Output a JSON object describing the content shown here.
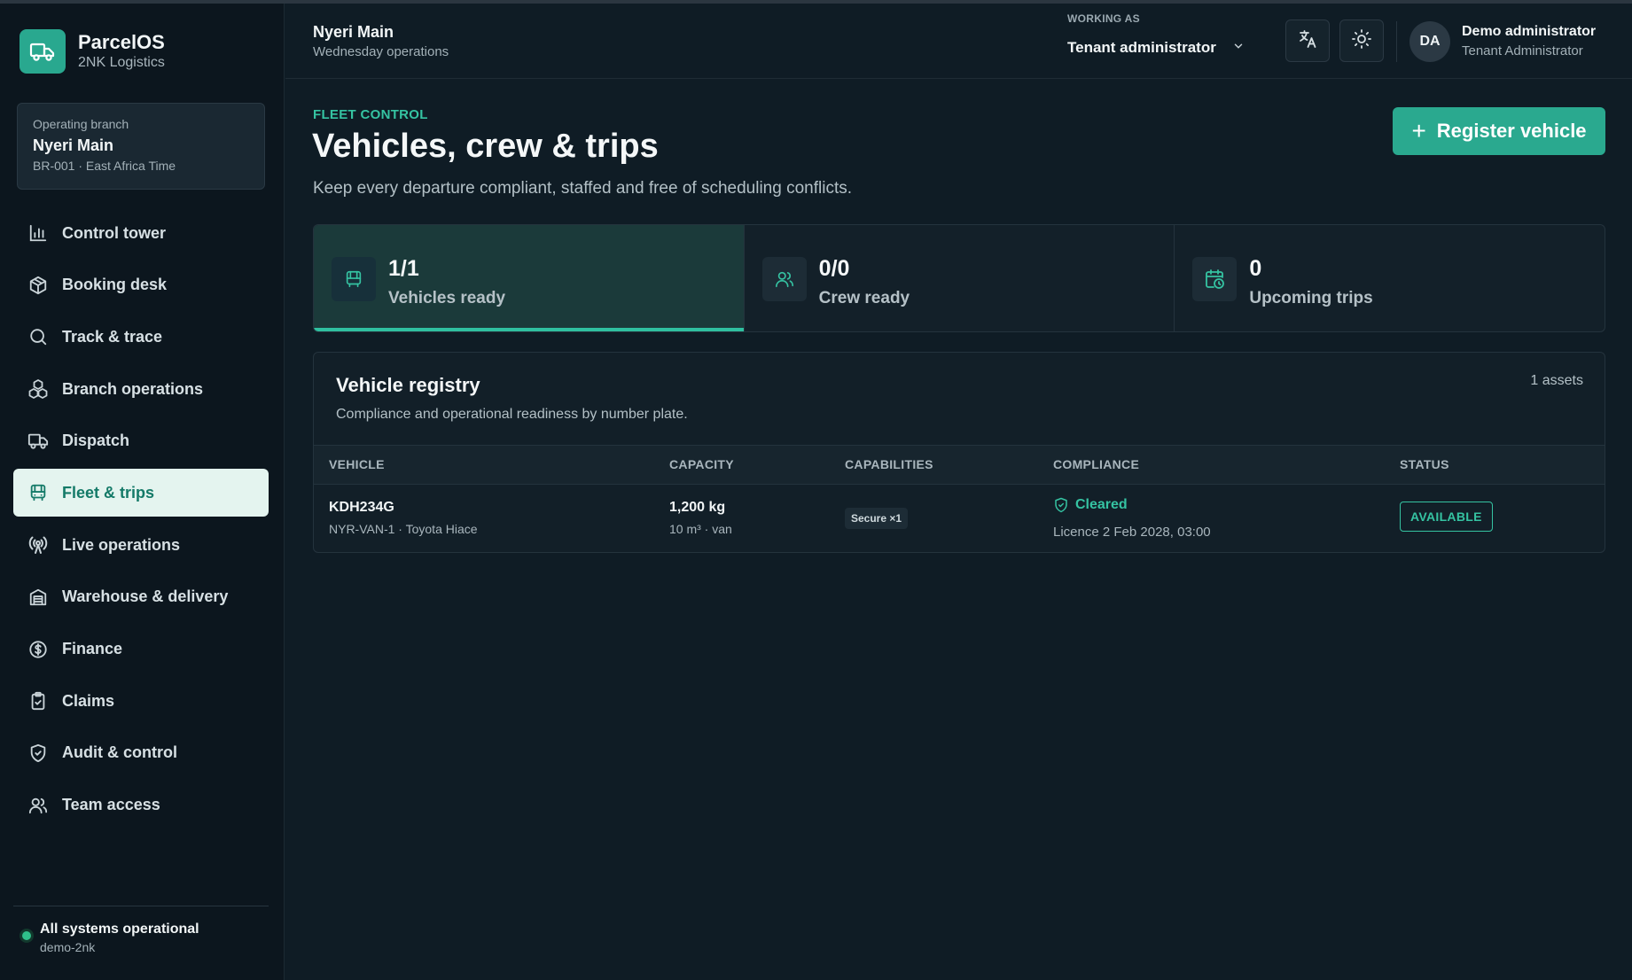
{
  "app": {
    "name": "ParcelOS",
    "tenant": "2NK Logistics"
  },
  "branch_card": {
    "label": "Operating branch",
    "name": "Nyeri Main",
    "meta": "BR-001 · East Africa Time"
  },
  "nav": [
    {
      "label": "Control tower",
      "icon": "bar-chart-icon"
    },
    {
      "label": "Booking desk",
      "icon": "package-icon"
    },
    {
      "label": "Track & trace",
      "icon": "search-icon"
    },
    {
      "label": "Branch operations",
      "icon": "boxes-icon"
    },
    {
      "label": "Dispatch",
      "icon": "truck-icon"
    },
    {
      "label": "Fleet & trips",
      "icon": "bus-icon",
      "active": true
    },
    {
      "label": "Live operations",
      "icon": "radio-icon"
    },
    {
      "label": "Warehouse & delivery",
      "icon": "warehouse-icon"
    },
    {
      "label": "Finance",
      "icon": "dollar-circle-icon"
    },
    {
      "label": "Claims",
      "icon": "clipboard-check-icon"
    },
    {
      "label": "Audit & control",
      "icon": "shield-check-icon"
    },
    {
      "label": "Team access",
      "icon": "users-icon"
    }
  ],
  "system_status": {
    "title": "All systems operational",
    "sub": "demo-2nk",
    "color": "#2fc08a"
  },
  "header": {
    "title": "Nyeri Main",
    "subtitle": "Wednesday operations",
    "working_as_label": "WORKING AS",
    "working_as_value": "Tenant administrator",
    "user": {
      "initials": "DA",
      "name": "Demo administrator",
      "role": "Tenant Administrator"
    }
  },
  "page": {
    "eyebrow": "FLEET CONTROL",
    "title": "Vehicles, crew & trips",
    "description": "Keep every departure compliant, staffed and free of scheduling conflicts.",
    "register_button": "Register vehicle"
  },
  "stats": [
    {
      "value": "1/1",
      "label": "Vehicles ready",
      "icon": "bus-icon",
      "active": true
    },
    {
      "value": "0/0",
      "label": "Crew ready",
      "icon": "users-icon"
    },
    {
      "value": "0",
      "label": "Upcoming trips",
      "icon": "calendar-clock-icon"
    }
  ],
  "registry": {
    "title": "Vehicle registry",
    "subtitle": "Compliance and operational readiness by number plate.",
    "count": "1 assets",
    "columns": [
      "VEHICLE",
      "CAPACITY",
      "CAPABILITIES",
      "COMPLIANCE",
      "STATUS"
    ],
    "rows": [
      {
        "plate": "KDH234G",
        "vehicle_detail": "NYR-VAN-1 · Toyota Hiace",
        "capacity": "1,200 kg",
        "capacity_detail": "10 m³ · van",
        "capability": "Secure ×1",
        "compliance": "Cleared",
        "compliance_detail": "Licence 2 Feb 2028, 03:00",
        "status": "AVAILABLE"
      }
    ]
  },
  "colors": {
    "accent": "#2aa98f",
    "accent_text": "#35c3a2",
    "background": "#0f1c25",
    "sidebar": "#0c161e"
  }
}
